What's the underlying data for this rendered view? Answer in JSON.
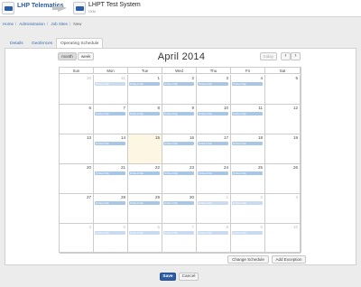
{
  "header": {
    "brand": "LHP Telematics",
    "system_title": "LHPT Test System",
    "system_sub": "CKM"
  },
  "breadcrumb": [
    "Home",
    "Administration",
    "Job Sites",
    "New"
  ],
  "tabs": [
    {
      "label": "Details",
      "active": false
    },
    {
      "label": "Geofences",
      "active": false
    },
    {
      "label": "Operating Schedule",
      "active": true
    }
  ],
  "calendar": {
    "view_month": "month",
    "view_week": "week",
    "title": "April 2014",
    "today_btn": "today",
    "prev_icon": "‹",
    "next_icon": "›",
    "dow": [
      "Sun",
      "Mon",
      "Tue",
      "Wed",
      "Thu",
      "Fri",
      "Sat"
    ],
    "weeks": [
      [
        {
          "d": "30",
          "o": true,
          "e": ""
        },
        {
          "d": "31",
          "o": true,
          "e": "8:00a-3:00p"
        },
        {
          "d": "1",
          "o": false,
          "e": "8:00a-3:00p"
        },
        {
          "d": "2",
          "o": false,
          "e": "8:00a-3:00p"
        },
        {
          "d": "3",
          "o": false,
          "e": "8:00a-3:00p"
        },
        {
          "d": "4",
          "o": false,
          "e": "8:00a-3:00p"
        },
        {
          "d": "5",
          "o": false,
          "e": ""
        }
      ],
      [
        {
          "d": "6",
          "o": false,
          "e": ""
        },
        {
          "d": "7",
          "o": false,
          "e": "8:00a-3:00p"
        },
        {
          "d": "8",
          "o": false,
          "e": "8:00a-3:00p"
        },
        {
          "d": "9",
          "o": false,
          "e": "8:00a-3:00p"
        },
        {
          "d": "10",
          "o": false,
          "e": "8:00a-3:00p"
        },
        {
          "d": "11",
          "o": false,
          "e": "8:00a-3:00p"
        },
        {
          "d": "12",
          "o": false,
          "e": ""
        }
      ],
      [
        {
          "d": "13",
          "o": false,
          "e": ""
        },
        {
          "d": "14",
          "o": false,
          "e": "8:00a-3:00p"
        },
        {
          "d": "15",
          "o": false,
          "e": "",
          "t": true
        },
        {
          "d": "16",
          "o": false,
          "e": "8:00a-3:00p"
        },
        {
          "d": "17",
          "o": false,
          "e": "8:00a-3:00p"
        },
        {
          "d": "18",
          "o": false,
          "e": "8:00a-3:00p"
        },
        {
          "d": "19",
          "o": false,
          "e": ""
        }
      ],
      [
        {
          "d": "20",
          "o": false,
          "e": ""
        },
        {
          "d": "21",
          "o": false,
          "e": "8:00a-3:00p"
        },
        {
          "d": "22",
          "o": false,
          "e": "8:00a-3:00p"
        },
        {
          "d": "23",
          "o": false,
          "e": "8:00a-3:00p"
        },
        {
          "d": "24",
          "o": false,
          "e": "8:00a-3:00p"
        },
        {
          "d": "25",
          "o": false,
          "e": "8:00a-3:00p"
        },
        {
          "d": "26",
          "o": false,
          "e": ""
        }
      ],
      [
        {
          "d": "27",
          "o": false,
          "e": ""
        },
        {
          "d": "28",
          "o": false,
          "e": "8:00a-3:00p"
        },
        {
          "d": "29",
          "o": false,
          "e": "8:00a-3:00p"
        },
        {
          "d": "30",
          "o": false,
          "e": "8:00a-3:00p"
        },
        {
          "d": "1",
          "o": true,
          "e": "8:00a-3:00p"
        },
        {
          "d": "2",
          "o": true,
          "e": "8:00a-3:00p"
        },
        {
          "d": "3",
          "o": true,
          "e": ""
        }
      ],
      [
        {
          "d": "4",
          "o": true,
          "e": ""
        },
        {
          "d": "5",
          "o": true,
          "e": "8:00a-3:00p"
        },
        {
          "d": "6",
          "o": true,
          "e": "8:00a-3:00p"
        },
        {
          "d": "7",
          "o": true,
          "e": "8:00a-3:00p"
        },
        {
          "d": "8",
          "o": true,
          "e": "8:00a-3:00p"
        },
        {
          "d": "9",
          "o": true,
          "e": "8:00a-3:00p"
        },
        {
          "d": "10",
          "o": true,
          "e": ""
        }
      ]
    ]
  },
  "actions": {
    "change_schedule": "Change Schedule",
    "add_exception": "Add Exception"
  },
  "footer": {
    "save": "Save",
    "cancel": "Cancel"
  },
  "colors": {
    "accent": "#2d5da6",
    "event": "#a8c6e6",
    "today": "#fcf6e2"
  }
}
